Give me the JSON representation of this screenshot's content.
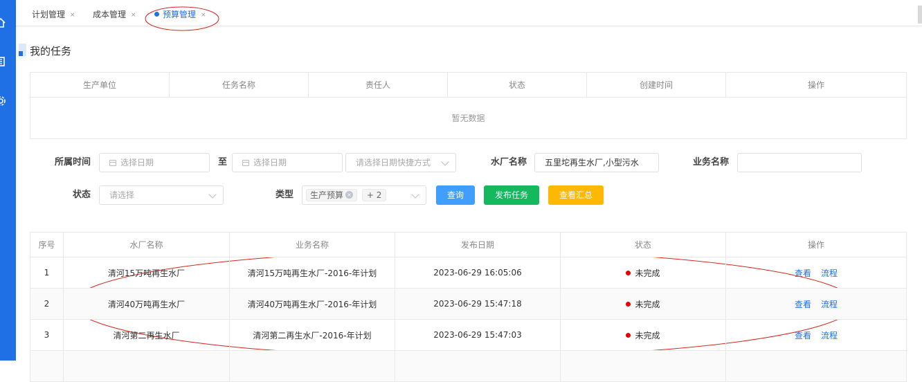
{
  "tabs": [
    {
      "label": "计划管理",
      "active": false
    },
    {
      "label": "成本管理",
      "active": false
    },
    {
      "label": "预算管理",
      "active": true
    }
  ],
  "tab_close": "×",
  "section_title": "我的任务",
  "task_table": {
    "columns": [
      "生产单位",
      "任务名称",
      "责任人",
      "状态",
      "创建时间",
      "操作"
    ],
    "empty_text": "暂无数据"
  },
  "filters": {
    "time_label": "所属时间",
    "start_placeholder": "选择日期",
    "to_label": "至",
    "end_placeholder": "选择日期",
    "quick_placeholder": "请选择日期快捷方式",
    "plant_label": "水厂名称",
    "plant_value": "五里坨再生水厂,小型污水",
    "biz_label": "业务名称",
    "biz_value": "",
    "status_label": "状态",
    "status_placeholder": "请选择",
    "type_label": "类型",
    "type_tag": "生产预算",
    "type_more": "+ 2"
  },
  "buttons": {
    "query": "查询",
    "publish": "发布任务",
    "summary": "查看汇总"
  },
  "data_table": {
    "columns": [
      "序号",
      "水厂名称",
      "业务名称",
      "发布日期",
      "状态",
      "操作"
    ],
    "rows": [
      {
        "no": "1",
        "plant": "清河15万吨再生水厂",
        "biz": "清河15万吨再生水厂-2016-年计划",
        "date": "2023-06-29 16:05:06",
        "status": "未完成"
      },
      {
        "no": "2",
        "plant": "清河40万吨再生水厂",
        "biz": "清河40万吨再生水厂-2016-年计划",
        "date": "2023-06-29 15:47:18",
        "status": "未完成"
      },
      {
        "no": "3",
        "plant": "清河第二再生水厂",
        "biz": "清河第二再生水厂-2016-年计划",
        "date": "2023-06-29 15:47:03",
        "status": "未完成"
      }
    ],
    "op_view": "查看",
    "op_flow": "流程"
  },
  "colors": {
    "primary": "#1f6fe5",
    "query_btn": "#409eff",
    "publish_btn": "#13b95c",
    "summary_btn": "#ffb800",
    "status_dot": "#e60000",
    "annotation": "#d9261c"
  },
  "icons": [
    "home-icon",
    "building-icon",
    "gear-icon"
  ]
}
